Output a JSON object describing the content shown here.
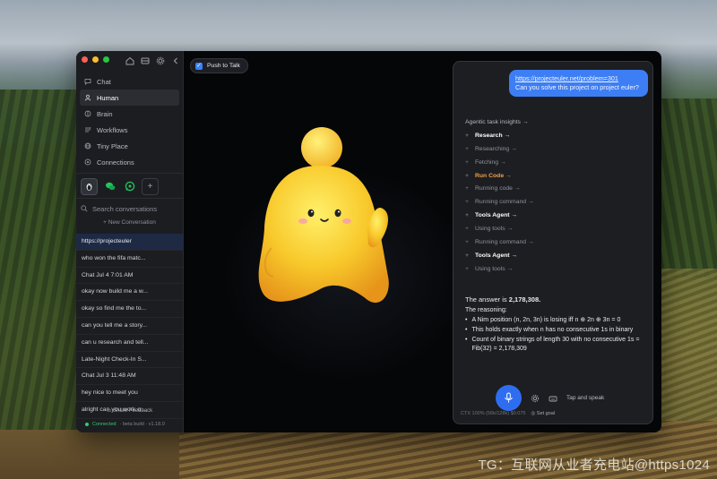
{
  "background": {
    "watermark": "TG：互联网从业者充电站@https1024"
  },
  "window": {
    "traffic_colors": [
      "#ff5f57",
      "#febc2e",
      "#28c840"
    ],
    "sidebar": {
      "nav": [
        {
          "label": "Chat",
          "icon": "chat-bubble-icon"
        },
        {
          "label": "Human",
          "icon": "person-icon"
        },
        {
          "label": "Brain",
          "icon": "brain-icon"
        },
        {
          "label": "Workflows",
          "icon": "workflow-icon"
        },
        {
          "label": "Tiny Place",
          "icon": "globe-icon"
        },
        {
          "label": "Connections",
          "icon": "connections-icon"
        }
      ],
      "search_placeholder": "Search conversations",
      "new_conversation": "+ New Conversation",
      "conversations": [
        "https://projecteuler",
        "who won the fifa matc...",
        "Chat Jul 4 7:01 AM",
        "okay now build me a w...",
        "okay so find me the to...",
        "can you tell me a story...",
        "can u research and tell...",
        "Late-Night Check-In S...",
        "Chat Jul 3 11:48 AM",
        "hey nice to meet you",
        "alright can you work o..."
      ],
      "feedback": "Share Feedback",
      "status_connected": "Connected",
      "status_build": "· beta build · v1.18.0"
    },
    "center": {
      "push_to_talk": "Push to Talk",
      "push_to_talk_checked": true
    },
    "chat": {
      "user_message_url": "https://projecteuler.net/problem=301",
      "user_message_text": "Can you solve this project on project euler?",
      "steps": [
        {
          "label": "Agentic task insights →",
          "style": "title",
          "plus": false
        },
        {
          "label": "Research →",
          "style": "bold",
          "plus": true
        },
        {
          "label": "Researching →",
          "style": "normal",
          "plus": true
        },
        {
          "label": "Fetching →",
          "style": "normal",
          "plus": true
        },
        {
          "label": "Run Code →",
          "style": "orange",
          "plus": true
        },
        {
          "label": "Running code →",
          "style": "normal",
          "plus": true
        },
        {
          "label": "Running command →",
          "style": "normal",
          "plus": true
        },
        {
          "label": "Tools Agent →",
          "style": "bold",
          "plus": true
        },
        {
          "label": "Using tools →",
          "style": "normal",
          "plus": true
        },
        {
          "label": "Running command →",
          "style": "normal",
          "plus": true
        },
        {
          "label": "Tools Agent →",
          "style": "bold",
          "plus": true
        },
        {
          "label": "Using tools →",
          "style": "normal",
          "plus": true
        }
      ],
      "answer_prefix": "The answer is ",
      "answer_value": "2,178,308.",
      "reasoning_title": "The reasoning:",
      "bullets": [
        "A Nim position (n, 2n, 3n) is losing iff n ⊕ 2n ⊕ 3n = 0",
        "This holds exactly when n has no consecutive 1s in binary",
        "Count of binary strings of length 30 with no consecutive 1s = Fib(32) = 2,178,309"
      ],
      "tap_to_speak": "Tap and speak",
      "footer_stats": "CTX 100% (56k/128k) $0.075",
      "footer_goal": "Set goal"
    }
  }
}
